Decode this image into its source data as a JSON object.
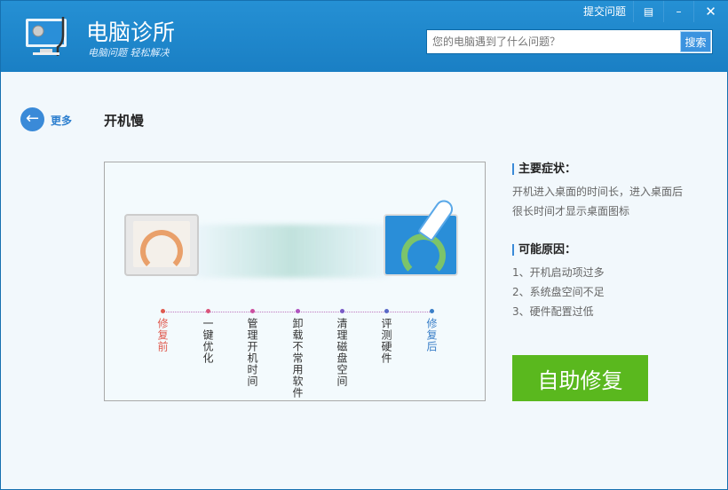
{
  "header": {
    "title": "电脑诊所",
    "slogan": "电脑问题 轻松解决",
    "submit_label": "提交问题",
    "search_placeholder": "您的电脑遇到了什么问题？",
    "search_button": "搜索"
  },
  "nav": {
    "back_label": "更多",
    "page_title": "开机慢"
  },
  "steps": [
    {
      "label": "修复前",
      "color": "#e05a4f"
    },
    {
      "label": "一键优化",
      "color": "#d9537a"
    },
    {
      "label": "管理开机时间",
      "color": "#cc4fa0"
    },
    {
      "label": "卸载不常用软件",
      "color": "#b055c0"
    },
    {
      "label": "清理磁盘空间",
      "color": "#7a5cc8"
    },
    {
      "label": "评测硬件",
      "color": "#5a6ac8"
    },
    {
      "label": "修复后",
      "color": "#3a7fc8"
    }
  ],
  "symptoms": {
    "title": "主要症状：",
    "text1": "开机进入桌面的时间长，进入桌面后",
    "text2": "很长时间才显示桌面图标"
  },
  "causes": {
    "title": "可能原因：",
    "items": [
      "1、开机启动项过多",
      "2、系统盘空间不足",
      "3、硬件配置过低"
    ]
  },
  "fix_button": "自助修复"
}
